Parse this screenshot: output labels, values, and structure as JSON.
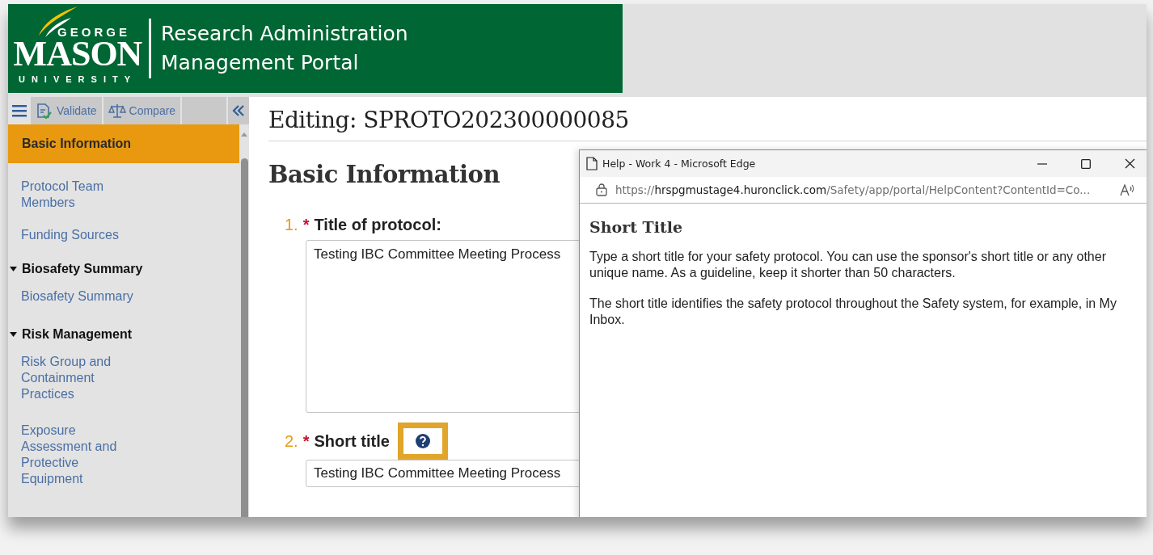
{
  "header": {
    "logo": {
      "top": "GEORGE",
      "main": "MASON",
      "bottom": "UNIVERSITY"
    },
    "portal_title": [
      "Research Administration",
      "Management Portal"
    ]
  },
  "toolbar": {
    "buttons": [
      {
        "kind": "validate",
        "label": "Validate"
      },
      {
        "kind": "compare",
        "label": "Compare"
      }
    ]
  },
  "sidebar": {
    "items": [
      {
        "kind": "link",
        "label": "Basic Information",
        "selected": true
      },
      {
        "kind": "link",
        "label": "Protocol Team Members",
        "selected": false
      },
      {
        "kind": "link",
        "label": "Funding Sources",
        "selected": false
      },
      {
        "kind": "section",
        "label": "Biosafety Summary",
        "expanded": true,
        "children": [
          {
            "kind": "link",
            "label": "Biosafety Summary",
            "selected": false
          }
        ]
      },
      {
        "kind": "section",
        "label": "Risk Management",
        "expanded": true,
        "children": [
          {
            "kind": "link",
            "label": "Risk Group and Containment Practices",
            "selected": false
          },
          {
            "kind": "link",
            "label": "Exposure Assessment and Protective Equipment",
            "selected": false
          }
        ]
      }
    ]
  },
  "content": {
    "editing_title": "Editing: SPROTO202300000085",
    "section_title": "Basic Information",
    "questions": [
      {
        "number": "1.",
        "required_mark": "*",
        "label": "Title of protocol:",
        "kind": "textarea",
        "value": "Testing IBC Committee Meeting Process",
        "help": false
      },
      {
        "number": "2.",
        "required_mark": "*",
        "label": "Short title",
        "kind": "input",
        "value": "Testing IBC Committee Meeting Process",
        "help": true
      }
    ]
  },
  "help_window": {
    "title": "Help - Work 4 - Microsoft Edge",
    "url": {
      "scheme": "https://",
      "host": "hrspgmustage4.huronclick.com",
      "path": "/Safety/app/portal/HelpContent?ContentId=Co..."
    },
    "heading": "Short Title",
    "paragraphs": [
      "Type a short title for your safety protocol. You can use the sponsor's short title or any other unique name. As a guideline, keep it shorter than 50 characters.",
      "The short title identifies the safety protocol throughout the Safety system, for example, in My Inbox."
    ]
  }
}
